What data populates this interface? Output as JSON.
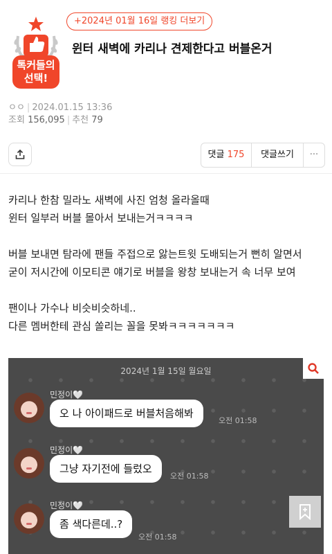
{
  "badge": {
    "line1": "톡커들의",
    "line2": "선택!"
  },
  "ranking_chip": "+2024년 01월 16일 랭킹 더보기",
  "title": "윈터 새벽에 카리나 견제한다고 버블온거",
  "meta": {
    "author": "ㅇㅇ",
    "date": "2024.01.15 13:36",
    "views_label": "조회",
    "views": "156,095",
    "recommend_label": "추천",
    "recommend": "79"
  },
  "toolbar": {
    "comments_label": "댓글",
    "comments_count": "175",
    "write_comment": "댓글쓰기",
    "more": "···"
  },
  "body": {
    "p1": [
      "카리나 한참 밀라노 새벽에 사진 엄청 올라올때",
      "윈터 일부러 버블 몰아서 보내는거ㅋㅋㅋㅋ"
    ],
    "p2": [
      "버블 보내면 탐라에 팬들 주접으로 앓는트윗 도배되는거 뻔히 알면서",
      "굳이 저시간에 이모티콘 얘기로 버블을 왕창 보내는거 속 너무 보여"
    ],
    "p3": [
      "팬이나 가수나 비슷비슷하네..",
      "다른 멤버한테 관심 쏠리는 꼴을 못봐ㅋㅋㅋㅋㅋㅋㅋ"
    ]
  },
  "chat": {
    "date": "2024년 1월 15일 월요일",
    "messages": [
      {
        "sender": "민정이",
        "heart": "🤍",
        "text": "오 나 아이패드로 버블처음해봐",
        "time": "오전 01:58"
      },
      {
        "sender": "민정이",
        "heart": "🤍",
        "text": "그냥 자기전에 들렀오",
        "time": "오전 01:58"
      },
      {
        "sender": "민정이",
        "heart": "🤍",
        "text": "좀 색다른데..?",
        "time": "오전 01:58"
      }
    ]
  },
  "colors": {
    "accent": "#f0462a",
    "chat_bg": "#4a4a4a"
  },
  "icons": [
    "trophy-badge-icon",
    "share-icon",
    "search-icon",
    "bookmark-icon"
  ]
}
